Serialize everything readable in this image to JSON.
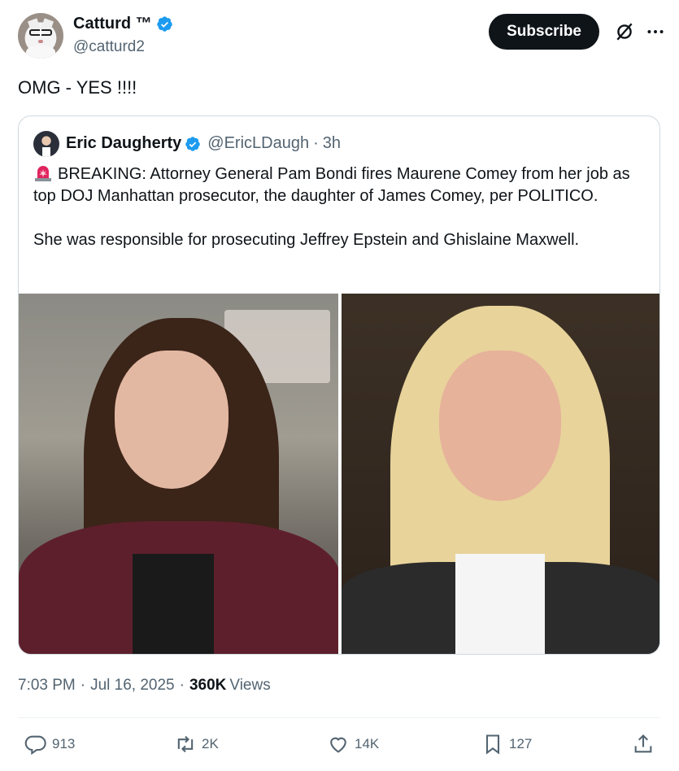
{
  "author": {
    "display_name": "Catturd ™",
    "handle": "@catturd2",
    "verified": true
  },
  "header": {
    "subscribe_label": "Subscribe",
    "icons": [
      "grok-icon",
      "more-icon"
    ]
  },
  "tweet": {
    "text": "OMG - YES !!!!"
  },
  "quote": {
    "display_name": "Eric Daugherty",
    "handle": "@EricLDaugh",
    "separator": "·",
    "time": "3h",
    "paragraph1": "BREAKING: Attorney General Pam Bondi fires Maurene Comey from her job as top DOJ Manhattan prosecutor, the daughter of James Comey, per POLITICO.",
    "paragraph2": "She was responsible for prosecuting Jeffrey Epstein and Ghislaine Maxwell.",
    "emoji": "siren-icon"
  },
  "meta": {
    "time": "7:03 PM",
    "sep1": "·",
    "date": "Jul 16, 2025",
    "sep2": "·",
    "views_count": "360K",
    "views_label": "Views"
  },
  "actions": {
    "replies": "913",
    "reposts": "2K",
    "likes": "14K",
    "bookmarks": "127"
  },
  "colors": {
    "verified_blue": "#1d9bf0",
    "text_primary": "#0f1419",
    "text_secondary": "#536471",
    "border": "#cfd9de"
  }
}
